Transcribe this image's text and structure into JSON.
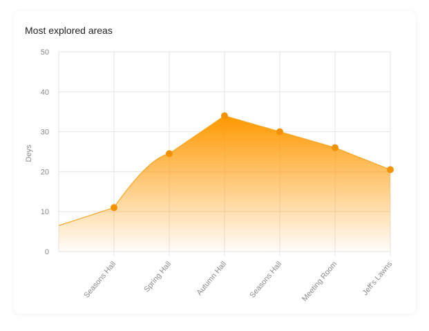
{
  "card": {
    "title": "Most explored areas"
  },
  "chart_data": {
    "type": "area",
    "title": "Most explored areas",
    "xlabel": "",
    "ylabel": "Deys",
    "ylim": [
      0,
      50
    ],
    "yticks": [
      0,
      10,
      20,
      30,
      40,
      50
    ],
    "categories": [
      "Seasons Hall",
      "Spring Hall",
      "Autumn Hall",
      "Seasons Hall",
      "Meeting Room",
      "Jeff's Lawns"
    ],
    "series": [
      {
        "values": [
          11,
          24.5,
          34,
          30,
          26,
          20.5
        ],
        "start_value": 6.5
      }
    ],
    "colors": {
      "line": "#f6a623",
      "marker": "#f39200",
      "fill_top": "#ff9800",
      "grid": "#e3e3e3"
    },
    "grid": true,
    "legend": "none"
  }
}
